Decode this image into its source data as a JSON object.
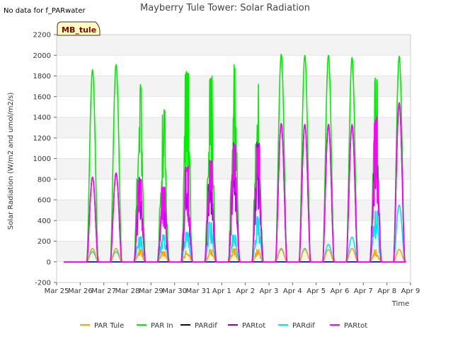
{
  "chart_data": {
    "type": "line",
    "title": "Mayberry Tule Tower: Solar Radiation",
    "xlabel": "Time",
    "ylabel": "Solar Radiation (W/m2 and umol/m2/s)",
    "no_data_note": "No data for f_PARwater",
    "site_badge": "MB_tule",
    "ylim": [
      -200,
      2200
    ],
    "yticks": [
      -200,
      0,
      200,
      400,
      600,
      800,
      1000,
      1200,
      1400,
      1600,
      1800,
      2000,
      2200
    ],
    "xlim": [
      0,
      15
    ],
    "x_ticks": [
      "Mar 25",
      "Mar 26",
      "Mar 27",
      "Mar 28",
      "Mar 29",
      "Mar 30",
      "Mar 31",
      "Apr 1",
      "Apr 2",
      "Apr 3",
      "Apr 4",
      "Apr 5",
      "Apr 6",
      "Apr 7",
      "Apr 8",
      "Apr 9"
    ],
    "days": [
      "Mar 25",
      "Mar 26",
      "Mar 27",
      "Mar 28",
      "Mar 29",
      "Mar 30",
      "Mar 31",
      "Apr 1",
      "Apr 2",
      "Apr 3",
      "Apr 4",
      "Apr 5",
      "Apr 6",
      "Apr 7",
      "Apr 8"
    ],
    "grid": true,
    "legend_position": "bottom",
    "series": [
      {
        "name": "PAR Tule",
        "color": "#ffa500",
        "daily_peaks": [
          130,
          130,
          120,
          100,
          110,
          120,
          130,
          120,
          130,
          120,
          120,
          130,
          120,
          120
        ]
      },
      {
        "name": "PAR In",
        "color": "#00ee00",
        "daily_peaks": [
          1860,
          1910,
          1730,
          1500,
          1850,
          1800,
          1930,
          1730,
          2010,
          2000,
          2000,
          1980,
          1830,
          1990
        ]
      },
      {
        "name": "PARdif",
        "color": "#00008b",
        "daily_peaks": [
          0,
          0,
          0,
          0,
          0,
          0,
          0,
          0,
          0,
          0,
          0,
          0,
          0,
          0
        ]
      },
      {
        "name": "PARtot",
        "color": "#9400d3",
        "daily_peaks": [
          820,
          860,
          820,
          750,
          930,
          1020,
          1170,
          1170,
          1340,
          1330,
          1330,
          1330,
          1420,
          1540
        ]
      },
      {
        "name": "PARdif",
        "color": "#00e5ee",
        "daily_peaks": [
          100,
          100,
          250,
          270,
          290,
          390,
          260,
          440,
          120,
          130,
          170,
          240,
          500,
          550
        ]
      },
      {
        "name": "PARtot",
        "color": "#ff00ff",
        "daily_peaks": [
          820,
          860,
          810,
          740,
          930,
          1010,
          1160,
          1160,
          1340,
          1330,
          1330,
          1330,
          1410,
          1540
        ]
      }
    ]
  }
}
